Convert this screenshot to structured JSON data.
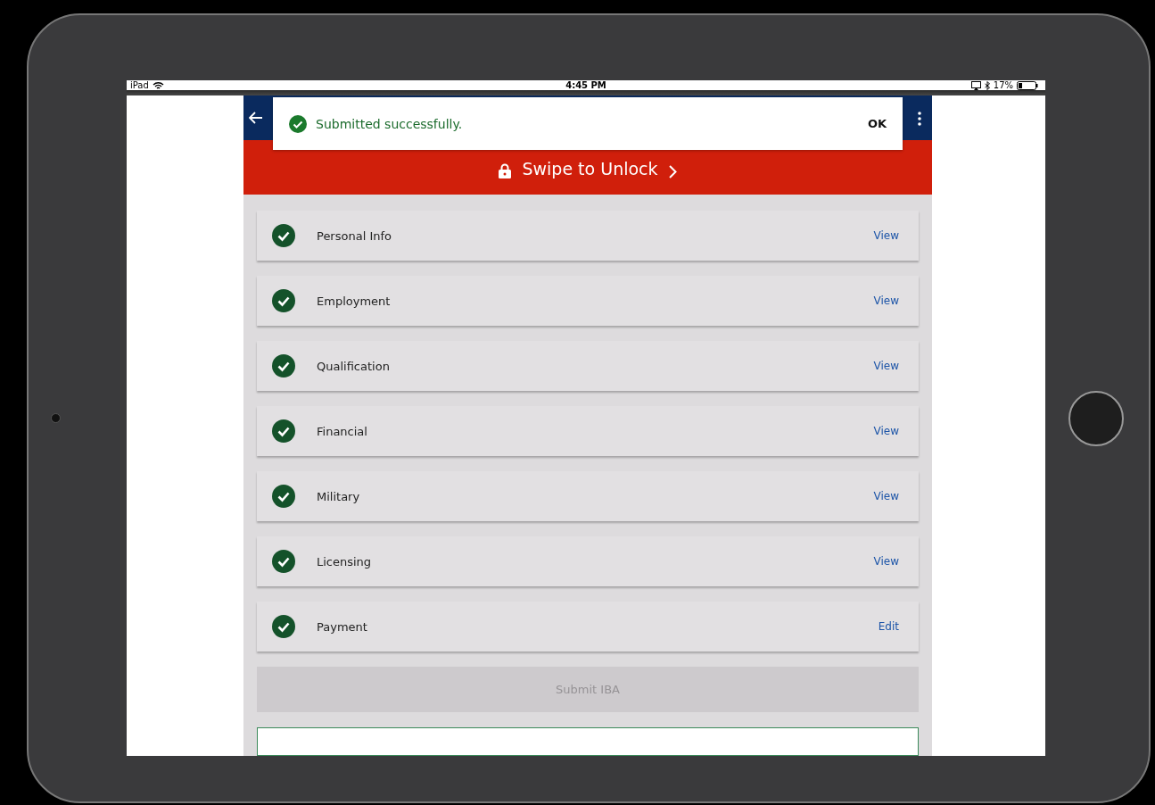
{
  "status_bar": {
    "device": "iPad",
    "time": "4:45 PM",
    "battery": "17%"
  },
  "toast": {
    "message": "Submitted successfully.",
    "action": "OK"
  },
  "lock_bar": {
    "label": "Swipe to Unlock"
  },
  "sections": [
    {
      "label": "Personal Info",
      "completed": true,
      "action": "View"
    },
    {
      "label": "Employment",
      "completed": true,
      "action": "View"
    },
    {
      "label": "Qualification",
      "completed": true,
      "action": "View"
    },
    {
      "label": "Financial",
      "completed": true,
      "action": "View"
    },
    {
      "label": "Military",
      "completed": true,
      "action": "View"
    },
    {
      "label": "Licensing",
      "completed": true,
      "action": "View"
    },
    {
      "label": "Payment",
      "completed": true,
      "action": "Edit"
    }
  ],
  "submit": {
    "label": "Submit IBA",
    "disabled": true
  }
}
